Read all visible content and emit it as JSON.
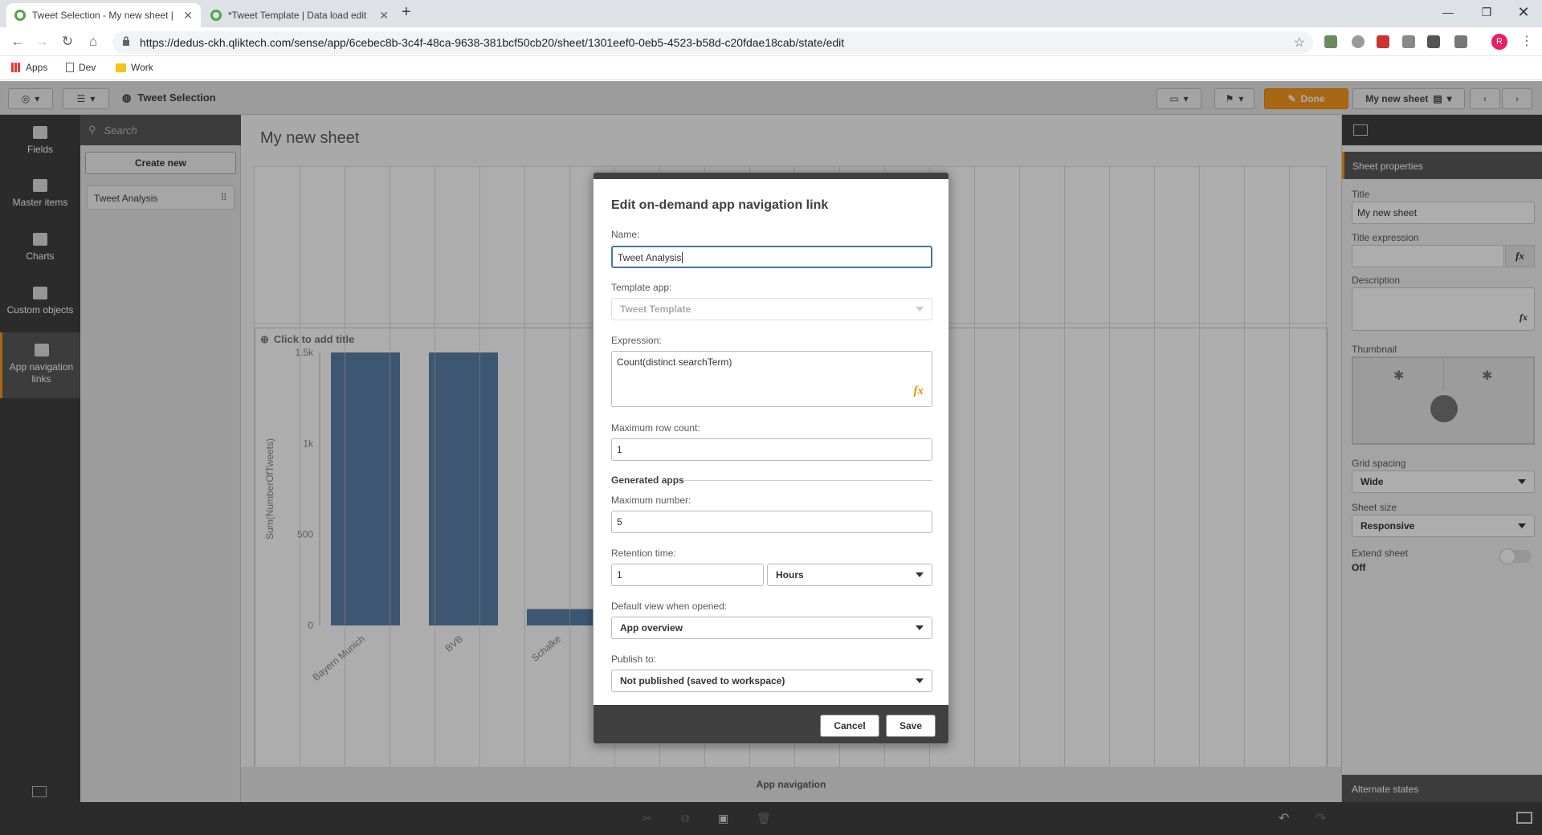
{
  "browser": {
    "tabs": [
      {
        "title": "Tweet Selection - My new sheet |"
      },
      {
        "title": "*Tweet Template | Data load edit"
      }
    ],
    "new_tab": "+",
    "url": "https://dedus-ckh.qliktech.com/sense/app/6cebec8b-3c4f-48ca-9638-381bcf50cb20/sheet/1301eef0-0eb5-4523-b58d-c20fdae18cab/state/edit",
    "profile_initial": "R",
    "bookmarks": [
      "Apps",
      "Dev",
      "Work"
    ]
  },
  "toolbar": {
    "app_title": "Tweet Selection",
    "done_label": "Done",
    "sheet_name": "My new sheet"
  },
  "left_nav": {
    "items": [
      {
        "label": "Fields",
        "icon": "database-icon"
      },
      {
        "label": "Master items",
        "icon": "link-icon"
      },
      {
        "label": "Charts",
        "icon": "bar-chart-icon"
      },
      {
        "label": "Custom objects",
        "icon": "puzzle-icon"
      },
      {
        "label": "App navigation links",
        "icon": "signpost-icon"
      }
    ]
  },
  "asset_panel": {
    "search_placeholder": "Search",
    "create_new": "Create new",
    "items": [
      "Tweet Analysis"
    ]
  },
  "sheet": {
    "title": "My new sheet",
    "chart_placeholder_title": "Click to add title",
    "bottom_label": "App navigation"
  },
  "chart_data": {
    "type": "bar",
    "title": "",
    "ylabel": "Sum(NumberOfTweets)",
    "categories": [
      "Bayern Munich",
      "BVB",
      "Schalke"
    ],
    "values": [
      1500,
      1500,
      90
    ],
    "ylim": [
      0,
      1500
    ],
    "yticks": [
      "1.5k",
      "1k",
      "500",
      "0"
    ],
    "bar_color": "#5b7fa8"
  },
  "right_panel": {
    "header": "Sheet properties",
    "title_label": "Title",
    "title_value": "My new sheet",
    "title_expr_label": "Title expression",
    "description_label": "Description",
    "thumbnail_label": "Thumbnail",
    "grid_spacing_label": "Grid spacing",
    "grid_spacing_value": "Wide",
    "sheet_size_label": "Sheet size",
    "sheet_size_value": "Responsive",
    "extend_label": "Extend sheet",
    "extend_value": "Off",
    "alternate_states": "Alternate states",
    "fx": "fx"
  },
  "dialog": {
    "title": "Edit on-demand app navigation link",
    "name_label": "Name:",
    "name_value": "Tweet Analysis",
    "template_label": "Template app:",
    "template_value": "Tweet Template",
    "expression_label": "Expression:",
    "expression_value": "Count(distinct searchTerm)",
    "fx": "fx",
    "max_rows_label": "Maximum row count:",
    "max_rows_value": "1",
    "generated_apps_label": "Generated apps",
    "max_number_label": "Maximum number:",
    "max_number_value": "5",
    "retention_label": "Retention time:",
    "retention_value": "1",
    "retention_unit": "Hours",
    "default_view_label": "Default view when opened:",
    "default_view_value": "App overview",
    "publish_label": "Publish to:",
    "publish_value": "Not published (saved to workspace)",
    "cancel": "Cancel",
    "save": "Save"
  },
  "colors": {
    "accent": "#f8981d",
    "nav_bg": "#404040"
  }
}
